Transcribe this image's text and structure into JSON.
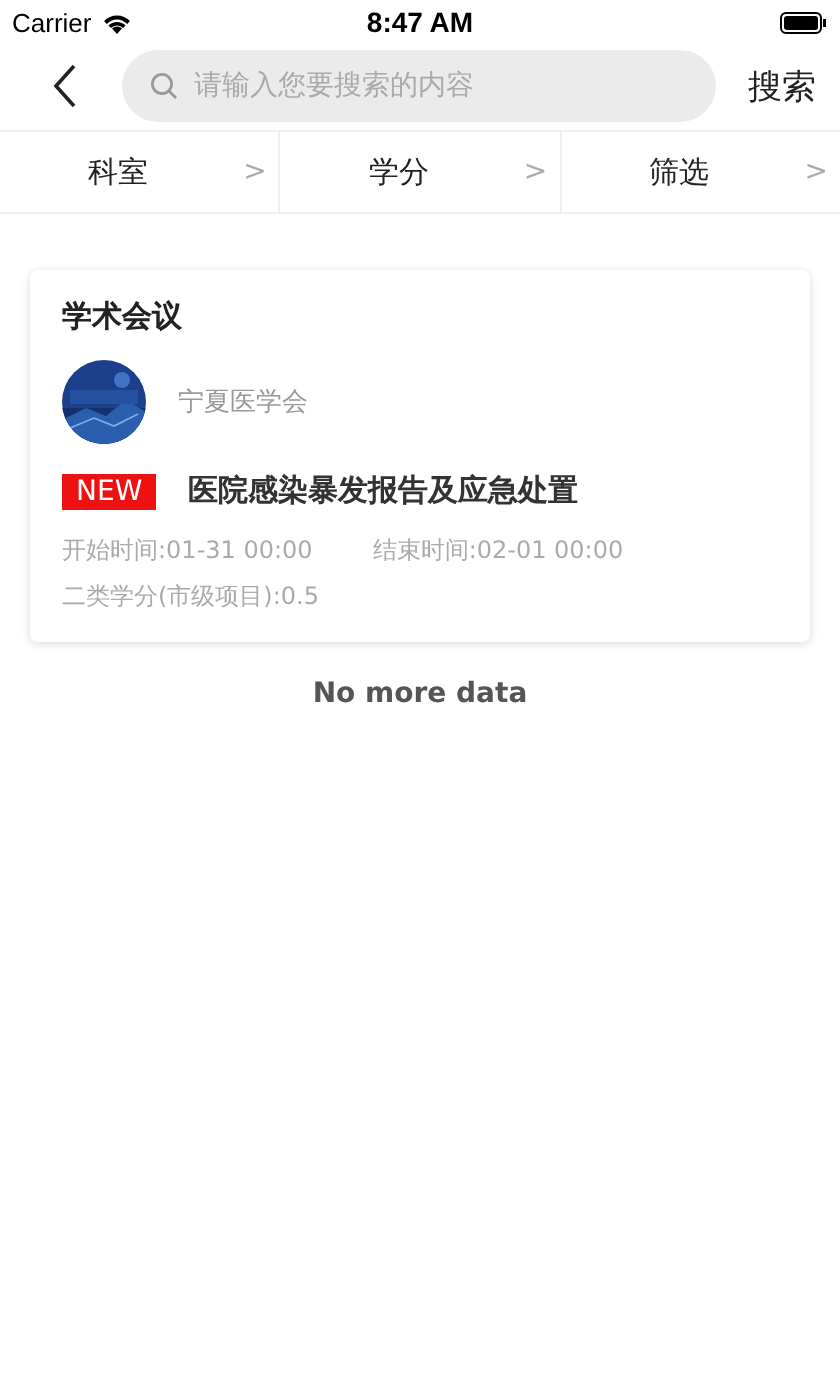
{
  "status_bar": {
    "carrier": "Carrier",
    "time": "8:47 AM"
  },
  "nav": {
    "search": {
      "placeholder": "请输入您要搜索的内容"
    },
    "action": "搜索"
  },
  "filters": [
    {
      "label": "科室",
      "chevron": ">"
    },
    {
      "label": "学分",
      "chevron": ">"
    },
    {
      "label": "筛选",
      "chevron": ">"
    }
  ],
  "cards": [
    {
      "category": "学术会议",
      "organizer": "宁夏医学会",
      "badge": "NEW",
      "title": "医院感染暴发报告及应急处置",
      "start": "开始时间:01-31 00:00",
      "end": "结束时间:02-01 00:00",
      "credit": "二类学分(市级项目):0.5"
    }
  ],
  "footer": "No more data"
}
